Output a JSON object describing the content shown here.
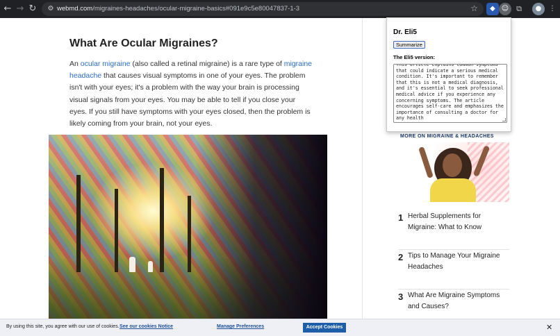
{
  "browser": {
    "url_domain": "webmd.com",
    "url_path": "/migraines-headaches/ocular-migraine-basics#091e9c5e80047837-1-3"
  },
  "article": {
    "heading": "What Are Ocular Migraines?",
    "p_prefix": "An ",
    "link1": "ocular migraine",
    "p_mid1": " (also called a retinal migraine) is a rare type of ",
    "link2": "migraine headache",
    "p_rest": " that causes visual symptoms in one of your eyes. The problem isn't with your eyes; it's a problem with the way your brain is processing visual signals from your eyes. You may be able to tell if you close your eyes. If you still have symptoms with your eyes closed, then the problem is likely coming from your brain, not your eyes."
  },
  "popup": {
    "title": "Dr. Eli5",
    "button_label": "Summarize",
    "version_label": "The Eli5 version:",
    "summary_text": "This article explains common symptoms that could indicate a serious medical condition. It's important to remember that this is not a medical diagnosis, and it's essential to seek professional medical advice if you experience any concerning symptoms. The article encourages self-care and emphasizes the importance of consulting a doctor for any health"
  },
  "sidebar": {
    "more_label": "MORE ON MIGRAINE & HEADACHES",
    "items": [
      {
        "num": "1",
        "title": "Herbal Supplements for Migraine: What to Know"
      },
      {
        "num": "2",
        "title": "Tips to Manage Your Migraine Headaches"
      },
      {
        "num": "3",
        "title": "What Are Migraine Symptoms and Causes?"
      }
    ]
  },
  "cookie": {
    "text": "By using this site, you agree with our use of cookies.",
    "notice_link": "See our cookies Notice",
    "manage_link": "Manage Preferences",
    "accept_label": "Accept Cookies",
    "close_symbol": "✕"
  },
  "colors": {
    "link": "#2b6cc4",
    "accept_button": "#1e5ea8",
    "chrome": "#202124"
  }
}
